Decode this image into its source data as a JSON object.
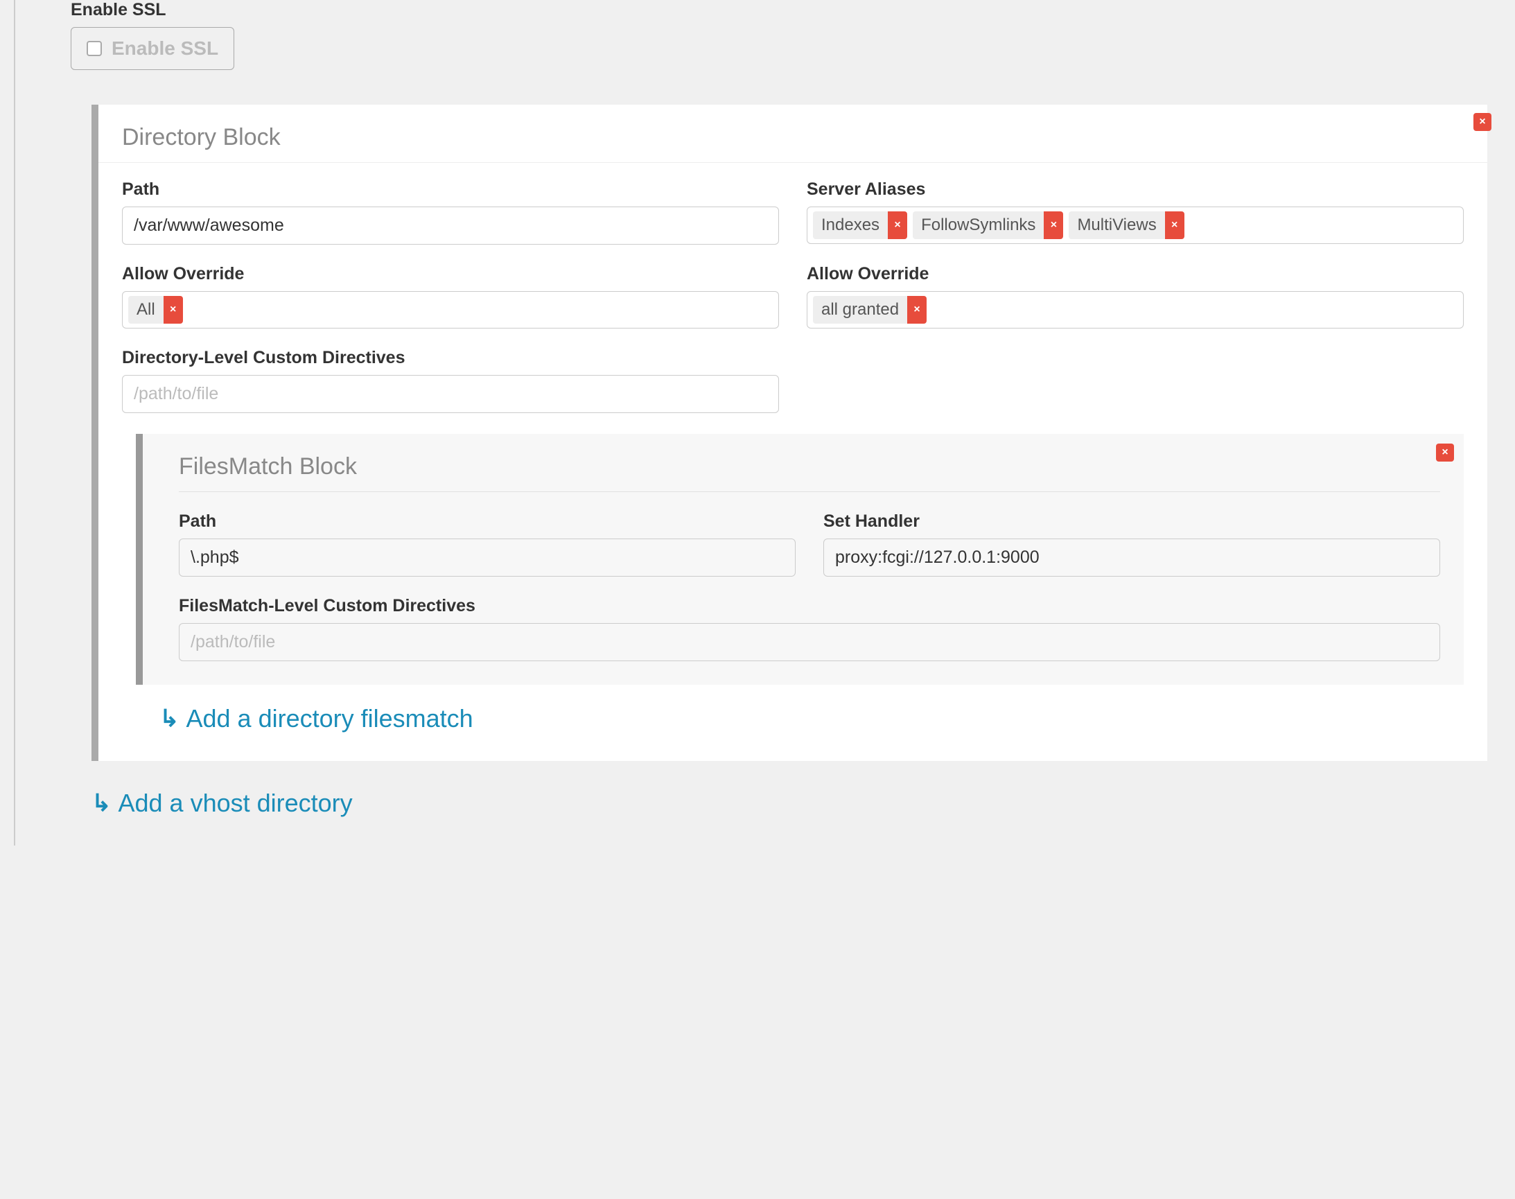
{
  "ssl": {
    "section_label": "Enable SSL",
    "checkbox_label": "Enable SSL"
  },
  "directory_block": {
    "title": "Directory Block",
    "path_label": "Path",
    "path_value": "/var/www/awesome",
    "server_aliases_label": "Server Aliases",
    "server_aliases_tags": [
      "Indexes",
      "FollowSymlinks",
      "MultiViews"
    ],
    "allow_override_left_label": "Allow Override",
    "allow_override_left_tags": [
      "All"
    ],
    "allow_override_right_label": "Allow Override",
    "allow_override_right_tags": [
      "all granted"
    ],
    "custom_directives_label": "Directory-Level Custom Directives",
    "custom_directives_placeholder": "/path/to/file"
  },
  "filesmatch_block": {
    "title": "FilesMatch Block",
    "path_label": "Path",
    "path_value": "\\.php$",
    "set_handler_label": "Set Handler",
    "set_handler_value": "proxy:fcgi://127.0.0.1:9000",
    "custom_directives_label": "FilesMatch-Level Custom Directives",
    "custom_directives_placeholder": "/path/to/file"
  },
  "links": {
    "add_filesmatch": "Add a directory filesmatch",
    "add_vhost_directory": "Add a vhost directory"
  },
  "icons": {
    "close": "×",
    "arrow": "↳"
  }
}
